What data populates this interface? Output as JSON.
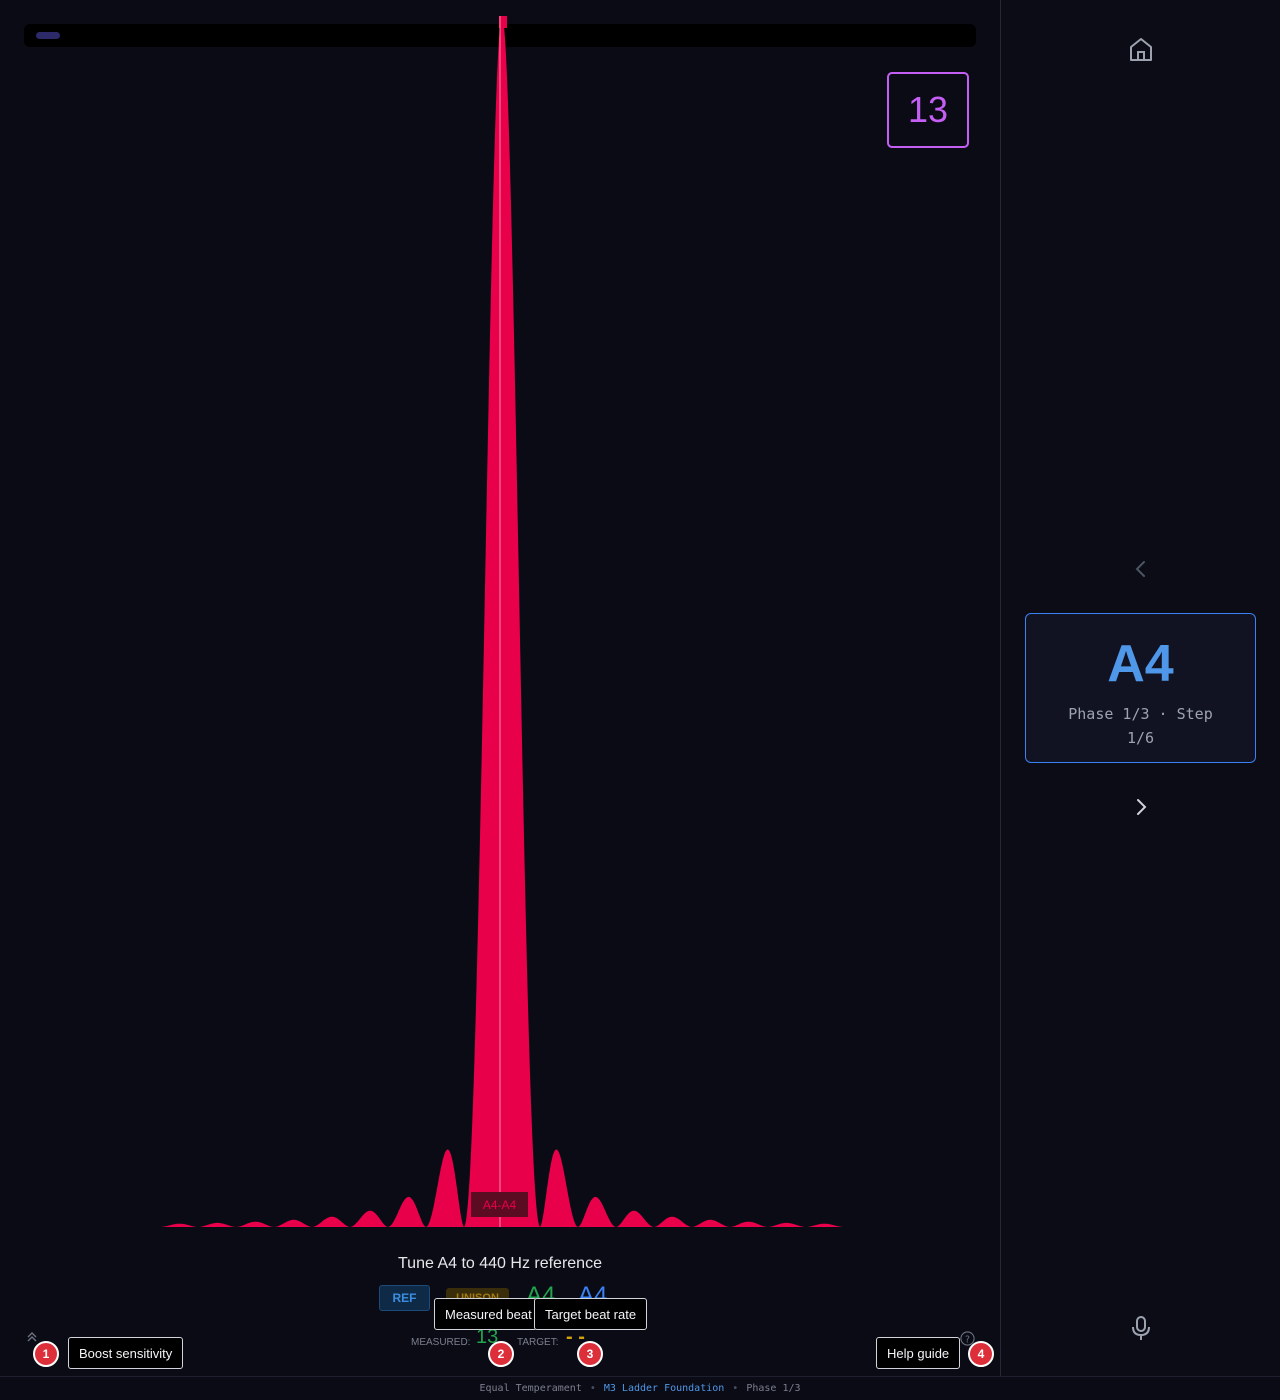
{
  "progress": {
    "fraction": 0.026
  },
  "beat_display": {
    "value": "13"
  },
  "spectrum": {
    "interval_label": "A4-A4",
    "color": "#e8004a"
  },
  "instruction": {
    "text": "Tune A4 to 440 Hz reference"
  },
  "badges": {
    "ref": "REF",
    "unison": "UNISON",
    "note_a": "A4",
    "note_b": "A4"
  },
  "readout": {
    "measured_label": "MEASURED:",
    "measured_value": "13",
    "target_label": "TARGET:",
    "target_value": "- -"
  },
  "tooltips": {
    "measured": "Measured beat rate",
    "target": "Target beat rate",
    "boost": "Boost sensitivity",
    "help": "Help guide"
  },
  "markers": [
    "1",
    "2",
    "3",
    "4"
  ],
  "sidebar": {
    "note": "A4",
    "subtitle": "Phase 1/3 · Step 1/6",
    "icons": [
      "home-icon",
      "chevron-left-icon",
      "chevron-right-icon",
      "microphone-icon"
    ]
  },
  "footer": {
    "temperament": "Equal Temperament",
    "sequence": "M3 Ladder Foundation",
    "phase": "Phase 1/3"
  },
  "colors": {
    "accent_blue": "#3b82f6",
    "beat_purple": "#c45ef5",
    "spectrum_red": "#e8004a",
    "measured_green": "#22a34e",
    "target_amber": "#d1a20a",
    "marker_red": "#dc2f3a"
  }
}
